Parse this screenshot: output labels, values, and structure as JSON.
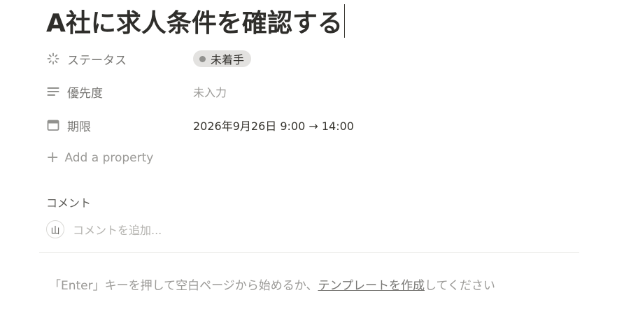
{
  "page": {
    "title": "A社に求人条件を確認する"
  },
  "properties": [
    {
      "name": "ステータス",
      "icon": "status-spinner-icon",
      "value": "未着手"
    },
    {
      "name": "優先度",
      "icon": "list-lines-icon",
      "value": "未入力"
    },
    {
      "name": "期限",
      "icon": "calendar-icon",
      "value": "2026年9月26日 9:00 → 14:00"
    }
  ],
  "add_property": {
    "label": "Add a property"
  },
  "comments": {
    "heading": "コメント",
    "avatar_initial": "山",
    "placeholder": "コメントを追加..."
  },
  "empty_hint": {
    "before": "「Enter」キーを押して空白ページから始めるか、",
    "link": "テンプレートを作成",
    "after": "してください"
  },
  "colors": {
    "status_pill_bg": "#e3e2e0",
    "status_dot": "#91918e",
    "muted_text": "#9b9a97"
  }
}
